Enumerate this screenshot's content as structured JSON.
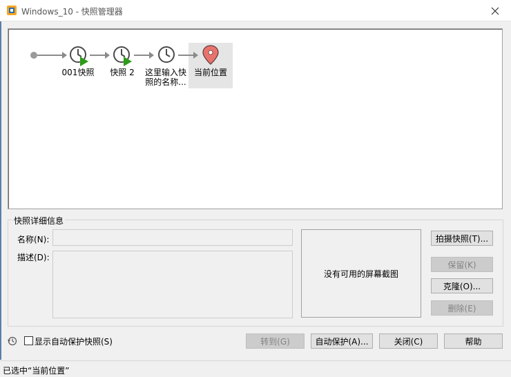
{
  "window": {
    "title": "Windows_10 - 快照管理器"
  },
  "colors": {
    "clock": "#4a4a4a",
    "play": "#2e9b1a",
    "pin": "#e8736c",
    "connector": "#8a8a8a"
  },
  "timeline": {
    "snapshots": [
      {
        "label": "001快照",
        "icon": "clock-icon"
      },
      {
        "label": "快照 2",
        "icon": "clock-icon"
      },
      {
        "label_line1": "这里输入快",
        "label_line2": "照的名称...",
        "icon": "clock-icon"
      }
    ],
    "current": {
      "label": "当前位置",
      "icon": "location-pin-icon"
    }
  },
  "details": {
    "group_title": "快照详细信息",
    "name_label": "名称(N):",
    "name_value": "",
    "desc_label": "描述(D):",
    "desc_value": "",
    "screenshot_text": "没有可用的屏幕截图"
  },
  "side_buttons": {
    "take": "拍摄快照(T)...",
    "keep": "保留(K)",
    "clone": "克隆(O)...",
    "delete": "删除(E)"
  },
  "bottom": {
    "show_autoprotect": "显示自动保护快照(S)",
    "goto": "转到(G)",
    "autoprotect": "自动保护(A)...",
    "close": "关闭(C)",
    "help": "帮助"
  },
  "status": {
    "text": "已选中“当前位置”"
  }
}
